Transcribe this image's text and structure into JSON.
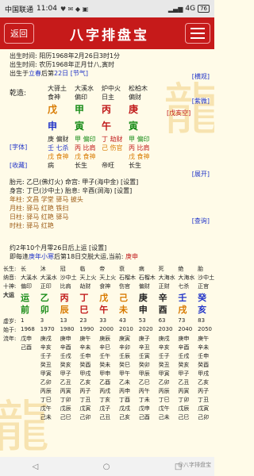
{
  "status": {
    "carrier": "中国联通",
    "time": "11:04",
    "right_info": "4G",
    "battery": "76"
  },
  "header": {
    "back": "返回",
    "title": "八字排盘宝"
  },
  "info": {
    "birth1": "出生时间: 阳历1968年2月26日3时1分",
    "birth2": "出生时间: 农历1968年正月廿八,寅时",
    "birth3_pre": "出生于",
    "birth3_term": "立春",
    "birth3_mid": "后第",
    "birth3_day": "22日",
    "birth3_link": "[节气]",
    "mode1": "[横观]",
    "mode2": "[紫微]",
    "mode3": "[字体]",
    "mode4": "[收藏]",
    "mode5": "[展开]",
    "mode6": "[查询]"
  },
  "pillars": {
    "label": "乾造:",
    "nayin": [
      "大驿土",
      "大溪水",
      "炉中火",
      "松柏木"
    ],
    "shishen": [
      "食神",
      "偏印",
      "日主",
      "偏财"
    ],
    "stems": [
      "戊",
      "甲",
      "丙",
      "庚"
    ],
    "branches": [
      "申",
      "寅",
      "午",
      "寅"
    ],
    "kongwang": "[戊亥空]",
    "hidden1": [
      "庚 偏财",
      "甲 偏印",
      "丁 劫财",
      "甲 偏印"
    ],
    "hidden2": [
      "壬 七杀",
      "丙 比肩",
      "己 伤官",
      "丙 比肩"
    ],
    "hidden3": [
      "戊 食神",
      "戊 食神",
      "",
      "戊 食神"
    ],
    "state": [
      "病",
      "长生",
      "帝旺",
      "长生"
    ]
  },
  "shensha": {
    "taiyuan": "胎元: 乙巳(佛灯火) 命宫: 甲子(海中金) [设置]",
    "shen1": "身宫: 丁巳(沙中土) 胎息: 辛酉(涧海) [设置]",
    "l1": "年柱: 文昌 学堂 驿马 披头",
    "l2": "月柱: 驿马 红艳 铁扫",
    "l3": "日柱: 驿马 红艳 驿马",
    "l4": "时柱: 驿马 红艳",
    "qiyun": "约2年10个月零26日后上运 [设置]",
    "jiaoyun_pre": "即每逢",
    "jiaoyun_year": "庚年小寒",
    "jiaoyun_mid": "后第18日交脱大运,当前: ",
    "jiaoyun_cur": "庚申"
  },
  "dayun": {
    "h_changsheng": [
      "长生:",
      "长",
      "沐",
      "冠",
      "临",
      "帝",
      "衰",
      "病",
      "死",
      "绝",
      "胎"
    ],
    "h_nayin": [
      "纳音:",
      "大溪水",
      "大溪水",
      "沙中土",
      "天上火",
      "天上火",
      "石榴木",
      "石榴木",
      "大海水",
      "大海水",
      "沙中土"
    ],
    "h_shishen": [
      "十神:",
      "偏印",
      "正印",
      "比肩",
      "劫财",
      "食神",
      "伤官",
      "偏财",
      "正财",
      "七杀",
      "正官"
    ],
    "stems": [
      "大运",
      "运",
      "乙",
      "丙",
      "丁",
      "戊",
      "己",
      "庚",
      "辛",
      "壬",
      "癸"
    ],
    "branches": [
      "",
      "前",
      "卯",
      "辰",
      "巳",
      "午",
      "未",
      "申",
      "酉",
      "戌",
      "亥"
    ],
    "ages": [
      "虚岁:",
      "1",
      "3",
      "13",
      "23",
      "33",
      "43",
      "53",
      "63",
      "73",
      "83"
    ],
    "years": [
      "始于:",
      "1968",
      "1970",
      "1980",
      "1990",
      "2000",
      "2010",
      "2020",
      "2030",
      "2040",
      "2050"
    ],
    "liunian": [
      "流年:",
      "戊申",
      "庚戌",
      "庚申",
      "庚午",
      "庚辰",
      "庚寅",
      "庚子",
      "庚戌",
      "庚申",
      "庚午"
    ]
  },
  "liunian_rows": [
    [
      "",
      "己酉",
      "辛亥",
      "辛酉",
      "辛未",
      "辛巳",
      "辛卯",
      "辛丑",
      "辛亥",
      "辛酉",
      "辛未"
    ],
    [
      "",
      "",
      "壬子",
      "壬戌",
      "壬申",
      "壬午",
      "壬辰",
      "壬寅",
      "壬子",
      "壬戌",
      "壬申"
    ],
    [
      "",
      "",
      "癸丑",
      "癸亥",
      "癸酉",
      "癸未",
      "癸巳",
      "癸卯",
      "癸丑",
      "癸亥",
      "癸酉"
    ],
    [
      "",
      "",
      "甲寅",
      "甲子",
      "甲戌",
      "甲申",
      "甲午",
      "甲辰",
      "甲寅",
      "甲子",
      "甲戌"
    ],
    [
      "",
      "",
      "乙卯",
      "乙丑",
      "乙亥",
      "乙酉",
      "乙未",
      "乙巳",
      "乙卯",
      "乙丑",
      "乙亥"
    ],
    [
      "",
      "",
      "丙辰",
      "丙寅",
      "丙子",
      "丙戌",
      "丙申",
      "丙午",
      "丙辰",
      "丙寅",
      "丙子"
    ],
    [
      "",
      "",
      "丁巳",
      "丁卯",
      "丁丑",
      "丁亥",
      "丁酉",
      "丁未",
      "丁巳",
      "丁卯",
      "丁丑"
    ],
    [
      "",
      "",
      "戊午",
      "戊辰",
      "戊寅",
      "戊子",
      "戊戌",
      "戊申",
      "戊午",
      "戊辰",
      "戊寅"
    ],
    [
      "",
      "",
      "己未",
      "己巳",
      "己卯",
      "己丑",
      "己亥",
      "己酉",
      "己未",
      "己巳",
      "己卯"
    ]
  ],
  "nav": {
    "back": "◁",
    "home": "○",
    "recent": "□"
  },
  "watermark": "@八字排盘宝"
}
